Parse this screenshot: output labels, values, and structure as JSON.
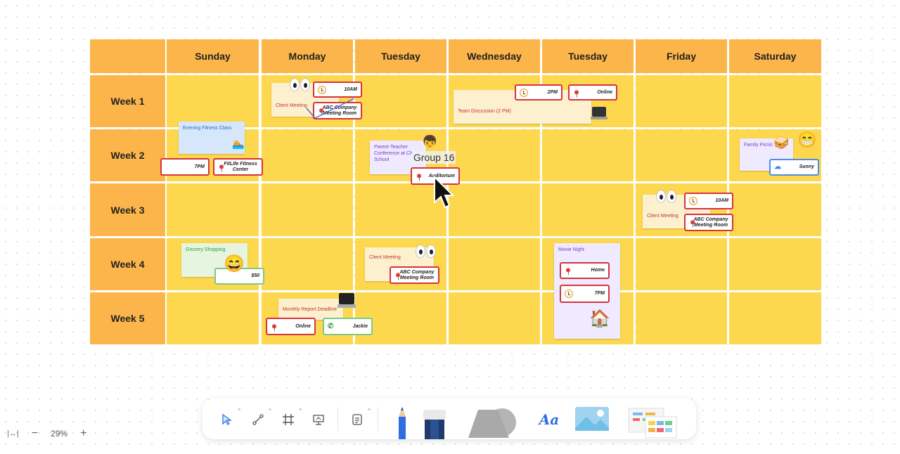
{
  "board": {
    "days": [
      "Sunday",
      "Monday",
      "Tuesday",
      "Wednesday",
      "Tuesday",
      "Friday",
      "Saturday"
    ],
    "weeks": [
      "Week 1",
      "Week 2",
      "Week 3",
      "Week 4",
      "Week 5"
    ]
  },
  "events": {
    "w1_monday": {
      "title": "Client Meeting",
      "time": "10AM",
      "location": "ABC Company Meeting Room"
    },
    "w1_wed": {
      "title": "Team Discussion (2 PM)",
      "time": "2PM",
      "location": "Online"
    },
    "w2_sunday": {
      "title": "Evening Fitness Class",
      "time": "7PM",
      "location": "FitLife Fitness Center"
    },
    "w2_tuesday": {
      "title": "Parent-Teacher Conference at Ch School",
      "location": "Auditorium"
    },
    "w2_saturday": {
      "title": "Family Picnic",
      "weather": "Sunny"
    },
    "w3_friday": {
      "title": "Client Meeting",
      "time": "10AM",
      "location": "ABC Company Meeting Room"
    },
    "w4_sunday": {
      "title": "Grocery Shopping",
      "amount": "$50"
    },
    "w4_tuesday": {
      "title": "Client Meeting",
      "location": "ABC Company Meeting Room"
    },
    "w4_thursday": {
      "title": "Movie Night",
      "location": "Home",
      "time": "7PM"
    },
    "w5_monday": {
      "title": "Monthly Report Deadline",
      "location": "Online",
      "contact": "Jackie"
    }
  },
  "overlay": {
    "group_label": "Group 16"
  },
  "zoom": {
    "fit_label": "|↔|",
    "minus": "−",
    "level": "29%",
    "plus": "+"
  },
  "toolbar": {
    "tools": [
      "select-tool",
      "connector-tool",
      "frame-tool",
      "presentation-tool",
      "text-template-tool",
      "pen-tool",
      "marker-tool",
      "shapes-tool",
      "text-style-tool",
      "image-tool",
      "templates-tool"
    ],
    "text_style_label": "Aa"
  },
  "colors": {
    "header": "#fcb54a",
    "cell": "#fdd84e",
    "tag_border": "#d6333c"
  }
}
